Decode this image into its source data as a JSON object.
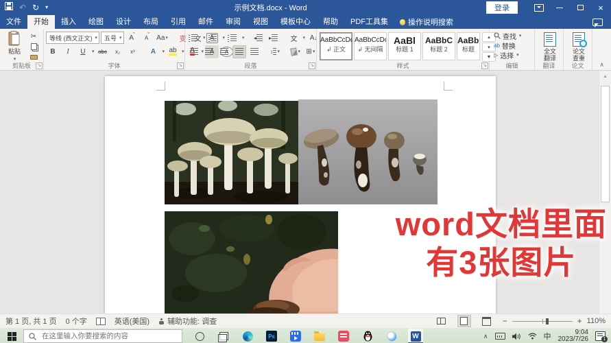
{
  "titlebar": {
    "title": "示例文档.docx - Word",
    "signin": "登录"
  },
  "tabs": {
    "file": "文件",
    "home": "开始",
    "insert": "插入",
    "draw": "绘图",
    "design": "设计",
    "layout": "布局",
    "references": "引用",
    "mailings": "邮件",
    "review": "审阅",
    "view": "视图",
    "template_center": "模板中心",
    "help": "帮助",
    "pdf_tools": "PDF工具集",
    "tell_me": "操作说明搜索"
  },
  "ribbon": {
    "clipboard": {
      "paste": "粘贴",
      "label": "剪贴板"
    },
    "font": {
      "name": "等线 (西文正文)",
      "size": "五号",
      "label": "字体"
    },
    "paragraph": {
      "label": "段落"
    },
    "styles": {
      "label": "样式",
      "items": [
        {
          "preview": "AaBbCcDd",
          "marker": "↲",
          "name": "正文"
        },
        {
          "preview": "AaBbCcDd",
          "marker": "↲",
          "name": "无间隔"
        },
        {
          "preview": "AaBl",
          "marker": "",
          "name": "标题 1"
        },
        {
          "preview": "AaBbC",
          "marker": "",
          "name": "标题 2"
        },
        {
          "preview": "AaBbC",
          "marker": "",
          "name": "标题"
        }
      ]
    },
    "editing": {
      "label": "编辑",
      "find": "查找",
      "replace": "替换",
      "select": "选择"
    },
    "translate": {
      "label": "翻译",
      "button": "全文翻译"
    },
    "paper": {
      "label": "论文",
      "button": "论文查重"
    }
  },
  "glyphs": {
    "dropdown": "▾",
    "up": "▴",
    "more": "▼",
    "close": "×",
    "undo": "↶",
    "redo": "↻",
    "cut": "✂",
    "bold": "B",
    "italic": "I",
    "underline": "U",
    "strike": "abc",
    "sub": "x₂",
    "sup": "x²",
    "A": "A",
    "caret_up": "ˆ",
    "caret_down": "ˇ",
    "aa": "Aa",
    "phonetic": "变",
    "char_scale": "文",
    "ab": "ab",
    "select_ptr": "▷",
    "pilcrow": "¶",
    "launcher": "↘",
    "arrow_left": "◂",
    "arrow_right": "▸",
    "arrow_down": "↓",
    "updown": "↕",
    "grid": "⊞",
    "collapse": "∧",
    "minus": "−",
    "plus": "+"
  },
  "document": {
    "overlay_line1": "word文档里面",
    "overlay_line2": "有3张图片"
  },
  "statusbar": {
    "page_info": "第 1 页, 共 1 页",
    "word_count": "0 个字",
    "language": "英语(美国)",
    "accessibility": "辅助功能: 调查",
    "zoom_level": "110%"
  },
  "taskbar": {
    "search_placeholder": "在这里输入你要搜索的内容",
    "ps": "Ps",
    "word": "W",
    "ime": "中",
    "time": "9:04",
    "date": "2023/7/26",
    "badge": "1"
  }
}
